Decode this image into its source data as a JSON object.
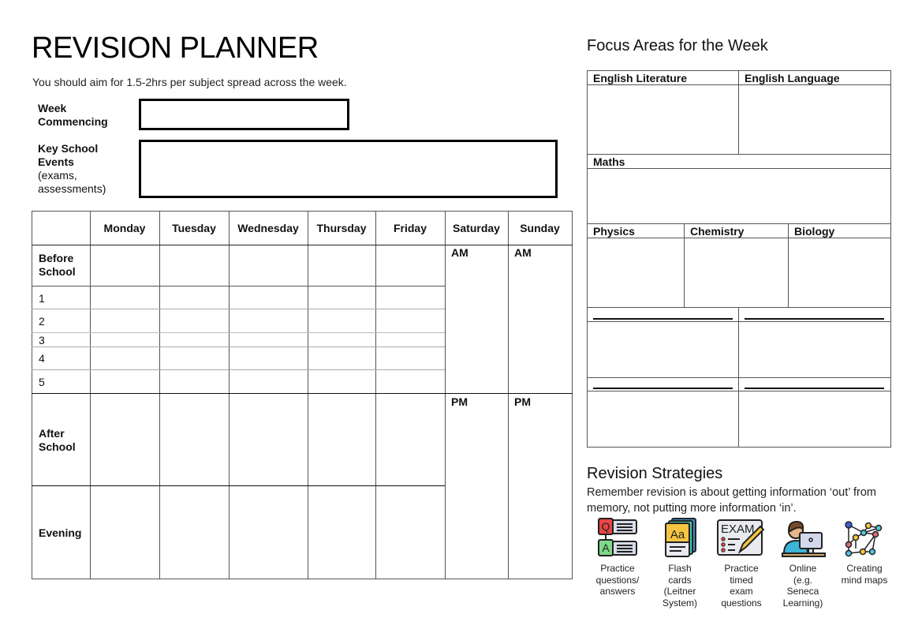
{
  "header": {
    "title": "REVISION PLANNER",
    "subtitle": "You should aim for 1.5-2hrs per subject spread across the week."
  },
  "form": {
    "week_commencing_label_line1": "Week",
    "week_commencing_label_line2": "Commencing",
    "week_commencing_value": "",
    "events_label_line1": "Key School",
    "events_label_line2": "Events",
    "events_label_line3": "(exams,",
    "events_label_line4": "assessments)",
    "events_value": ""
  },
  "planner": {
    "days": [
      "Monday",
      "Tuesday",
      "Wednesday",
      "Thursday",
      "Friday",
      "Saturday",
      "Sunday"
    ],
    "rows": {
      "before_school_1": "Before",
      "before_school_2": "School",
      "periods": [
        "1",
        "2",
        "3",
        "4",
        "5"
      ],
      "after_school_1": "After",
      "after_school_2": "School",
      "evening": "Evening"
    },
    "weekend": {
      "am": "AM",
      "pm": "PM"
    }
  },
  "focus": {
    "heading": "Focus Areas for the Week",
    "subjects": {
      "english_literature": "English Literature",
      "english_language": "English Language",
      "maths": "Maths",
      "physics": "Physics",
      "chemistry": "Chemistry",
      "biology": "Biology"
    }
  },
  "strategies": {
    "heading": "Revision Strategies",
    "note": "Remember revision is about getting information ‘out’ from memory, not putting more information ‘in’.",
    "items": [
      {
        "icon": "qa-icon",
        "line1": "Practice",
        "line2": "questions/",
        "line3": "answers",
        "line4": ""
      },
      {
        "icon": "flash-cards-icon",
        "line1": "Flash",
        "line2": "cards",
        "line3": "(Leitner",
        "line4": "System)"
      },
      {
        "icon": "exam-icon",
        "line1": "Practice",
        "line2": "timed",
        "line3": "exam",
        "line4": "questions"
      },
      {
        "icon": "online-learning-icon",
        "line1": "Online",
        "line2": "(e.g.",
        "line3": "Seneca",
        "line4": "Learning)"
      },
      {
        "icon": "mind-map-icon",
        "line1": "Creating",
        "line2": "mind maps",
        "line3": "",
        "line4": ""
      }
    ]
  }
}
